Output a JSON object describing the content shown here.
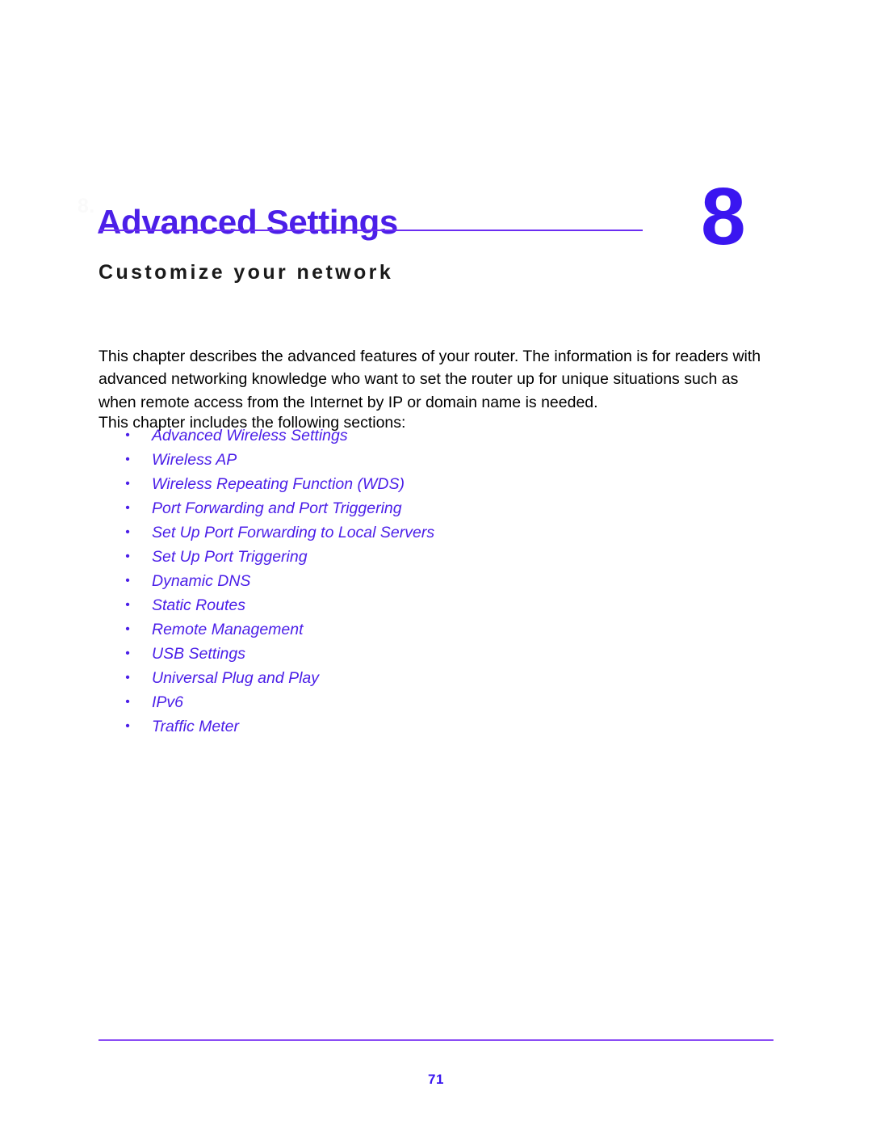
{
  "document": {
    "chapter_marker": "8.",
    "chapter_title": "Advanced Settings",
    "chapter_subtitle": "Customize your network",
    "chapter_number": "8",
    "accent_color": "#4b1fe8",
    "number_color": "#3a16f0",
    "rule_color": "#6b2df2",
    "footer_rule_color": "#8b4df5"
  },
  "body": {
    "intro_paragraph": "This chapter describes the advanced features of your router. The information is for readers with advanced networking knowledge who want to set the router up for unique situations such as when remote access from the Internet by IP or domain name is needed.",
    "sections_lead": "This chapter includes the following sections:",
    "bullet_glyph": "•"
  },
  "sections": [
    {
      "label": "Advanced Wireless Settings"
    },
    {
      "label": "Wireless AP"
    },
    {
      "label": "Wireless Repeating Function (WDS)"
    },
    {
      "label": "Port Forwarding and Port Triggering"
    },
    {
      "label": "Set Up Port Forwarding to Local Servers"
    },
    {
      "label": "Set Up Port Triggering"
    },
    {
      "label": "Dynamic DNS"
    },
    {
      "label": "Static Routes"
    },
    {
      "label": "Remote Management"
    },
    {
      "label": "USB Settings"
    },
    {
      "label": "Universal Plug and Play"
    },
    {
      "label": "IPv6"
    },
    {
      "label": "Traffic Meter"
    }
  ],
  "footer": {
    "page_number": "71"
  }
}
